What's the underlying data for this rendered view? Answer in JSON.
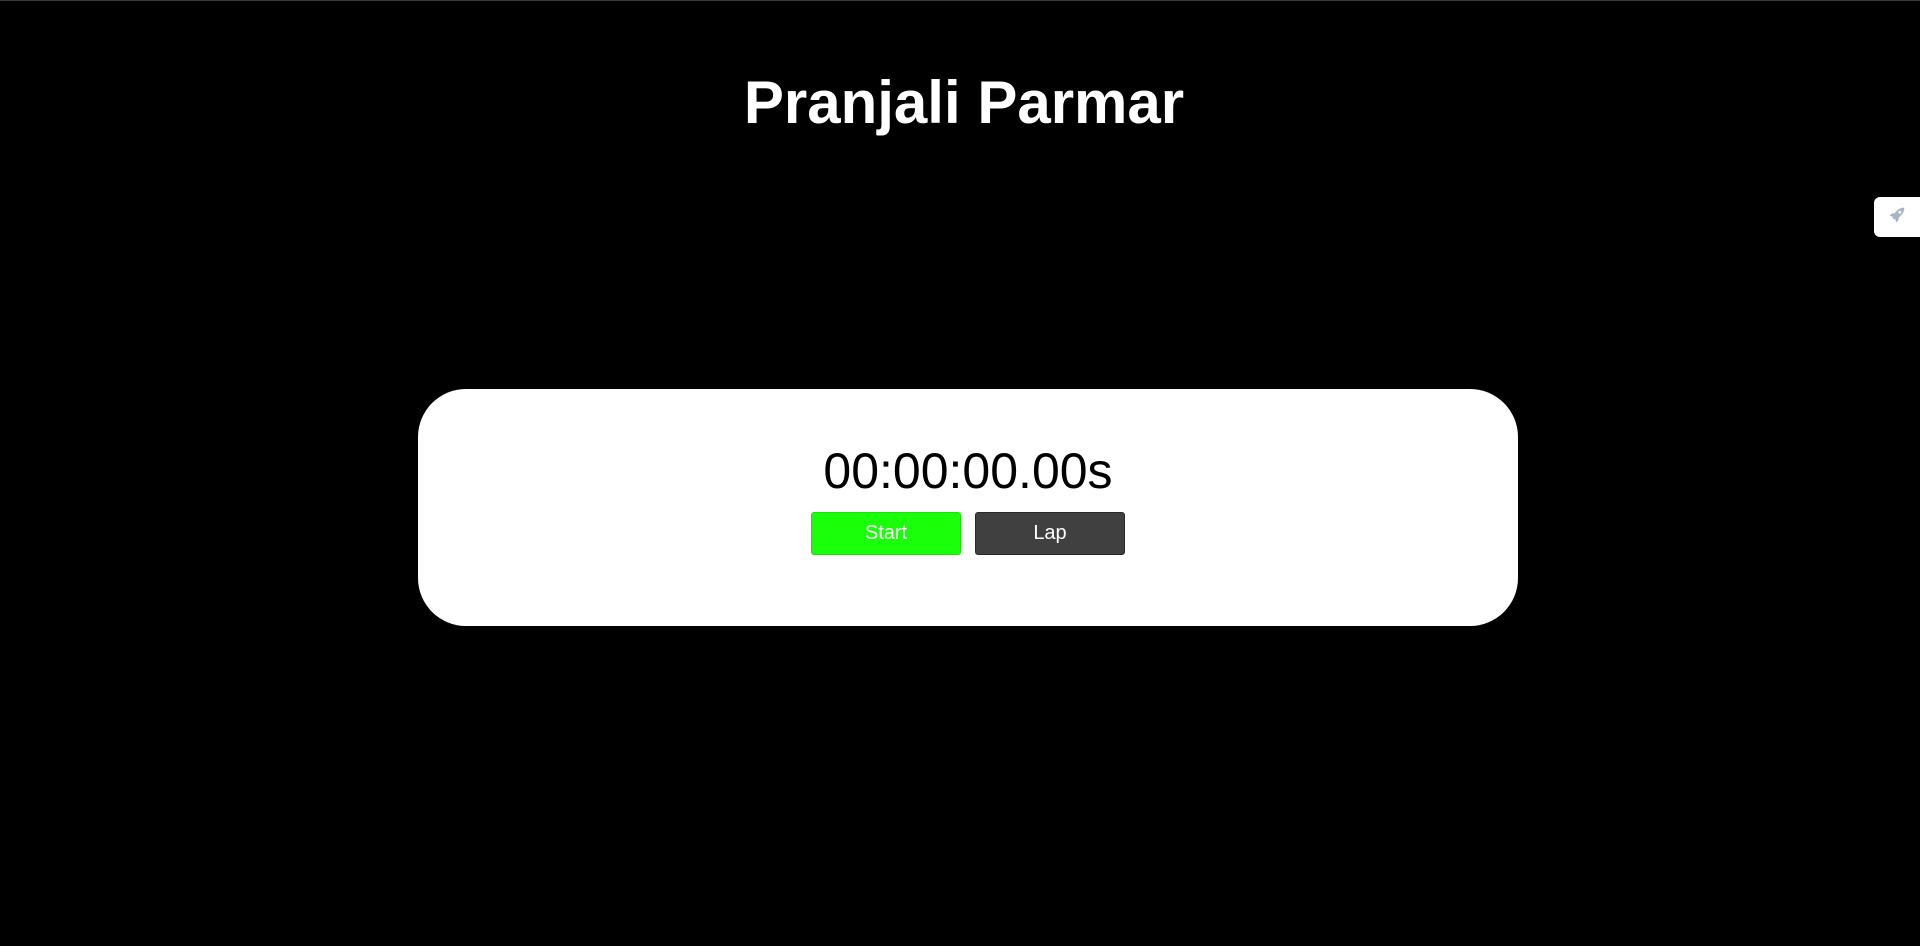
{
  "header": {
    "title": "Pranjali Parmar"
  },
  "stopwatch": {
    "time": "00:00:00.00s",
    "start_label": "Start",
    "lap_label": "Lap"
  },
  "launcher": {
    "icon": "rocket-icon"
  },
  "colors": {
    "background": "#000000",
    "card": "#ffffff",
    "start_button": "#1aff0a",
    "lap_button": "#404040"
  }
}
